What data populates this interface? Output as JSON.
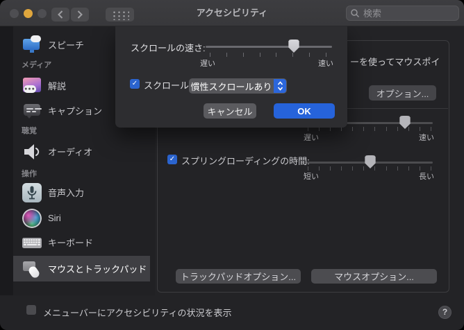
{
  "window": {
    "title": "アクセシビリティ",
    "search_placeholder": "検索"
  },
  "colors": {
    "accent_blue": "#2663da",
    "minimize_yellow": "#dfa63d",
    "checkbox_blue": "#2b64cf"
  },
  "sidebar": {
    "header_media": "メディア",
    "header_hearing": "聴覚",
    "header_motor": "操作",
    "items": [
      {
        "label": "スピーチ",
        "icon": "speech-icon",
        "selected": false
      },
      {
        "label": "解説",
        "icon": "audio-descriptions-icon",
        "selected": false
      },
      {
        "label": "キャプション",
        "icon": "captions-icon",
        "selected": false
      },
      {
        "label": "オーディオ",
        "icon": "audio-icon",
        "selected": false
      },
      {
        "label": "音声入力",
        "icon": "dictation-icon",
        "selected": false
      },
      {
        "label": "Siri",
        "icon": "siri-icon",
        "selected": false
      },
      {
        "label": "キーボード",
        "icon": "keyboard-icon",
        "selected": false
      },
      {
        "label": "マウスとトラックパッド",
        "icon": "mouse-trackpad-icon",
        "selected": true
      }
    ]
  },
  "sheet": {
    "speed_label": "スクロールの速さ:",
    "speed_slider": {
      "slow": "遅い",
      "fast": "速い",
      "value_percent": 70
    },
    "scroll_checkbox": {
      "label": "スクロール",
      "checked": true
    },
    "inertia_dropdown_value": "慣性スクロールあり",
    "cancel_label": "キャンセル",
    "ok_label": "OK"
  },
  "main": {
    "clipped_text": "ーを使ってマウスポイ",
    "options_button": "オプション...",
    "pointer_slider": {
      "slow": "遅い",
      "fast": "速い",
      "value_percent": 78
    },
    "spring_loading": {
      "label": "スプリングローディングの時間:",
      "checked": true,
      "short": "短い",
      "long": "長い",
      "value_percent": 51
    },
    "trackpad_options_button": "トラックパッドオプション...",
    "mouse_options_button": "マウスオプション..."
  },
  "footer": {
    "menu_bar_checkbox": {
      "label": "メニューバーにアクセシビリティの状況を表示",
      "checked": false
    },
    "help_label": "?"
  }
}
